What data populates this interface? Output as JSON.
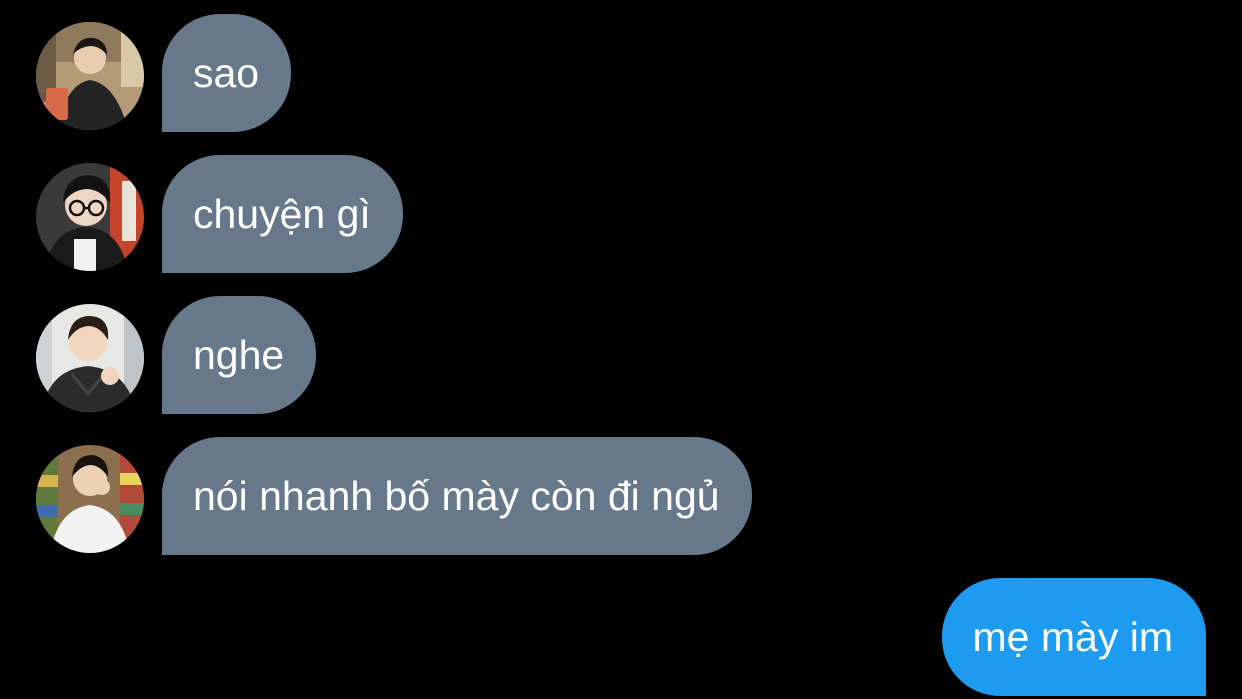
{
  "colors": {
    "background": "#000000",
    "incoming_bubble": "#67788a",
    "outgoing_bubble": "#1d9bf0",
    "text": "#ffffff"
  },
  "messages": [
    {
      "direction": "incoming",
      "avatar": "avatar-photo",
      "text": "sao"
    },
    {
      "direction": "incoming",
      "avatar": "avatar-photo",
      "text": "chuyện gì"
    },
    {
      "direction": "incoming",
      "avatar": "avatar-photo",
      "text": "nghe"
    },
    {
      "direction": "incoming",
      "avatar": "avatar-photo",
      "text": "nói nhanh bố mày còn đi ngủ"
    },
    {
      "direction": "outgoing",
      "text": "mẹ mày im"
    }
  ]
}
